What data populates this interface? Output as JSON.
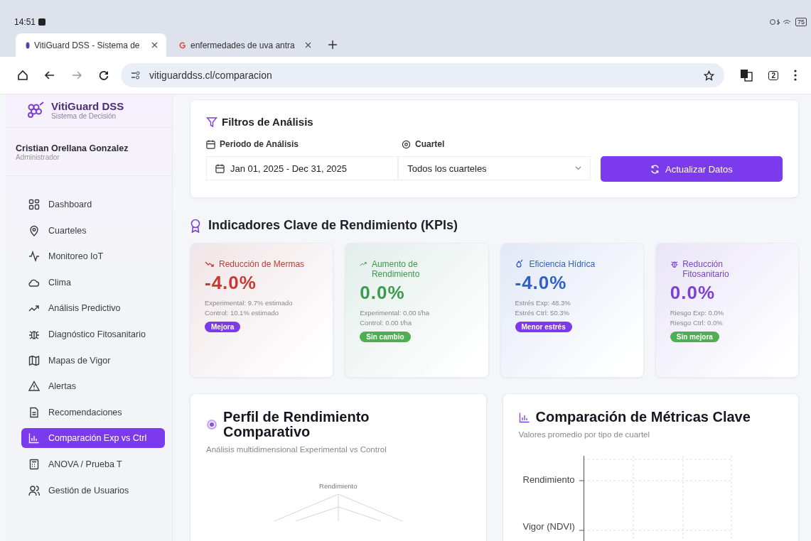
{
  "status_bar": {
    "time": "14:51",
    "battery": "75"
  },
  "browser_tabs": [
    {
      "title": "VitiGuard DSS - Sistema de",
      "selected": true
    },
    {
      "title": "enfermedades de uva antra",
      "selected": false
    }
  ],
  "address_bar": {
    "url": "vitiguarddss.cl/comparacion",
    "tab_count": "2"
  },
  "sidebar": {
    "brand": "VitiGuard DSS",
    "tagline": "Sistema de Decisión",
    "user": {
      "name": "Cristian Orellana Gonzalez",
      "role": "Administrador"
    },
    "items": [
      {
        "label": "Dashboard",
        "selected": false
      },
      {
        "label": "Cuarteles",
        "selected": false
      },
      {
        "label": "Monitoreo IoT",
        "selected": false
      },
      {
        "label": "Clima",
        "selected": false
      },
      {
        "label": "Análisis Predictivo",
        "selected": false
      },
      {
        "label": "Diagnóstico Fitosanitario",
        "selected": false
      },
      {
        "label": "Mapas de Vigor",
        "selected": false
      },
      {
        "label": "Alertas",
        "selected": false
      },
      {
        "label": "Recomendaciones",
        "selected": false
      },
      {
        "label": "Comparación Exp vs Ctrl",
        "selected": true
      },
      {
        "label": "ANOVA / Prueba T",
        "selected": false
      },
      {
        "label": "Gestión de Usuarios",
        "selected": false
      }
    ]
  },
  "filters": {
    "title": "Filtros de Análisis",
    "period": {
      "label": "Periodo de Análisis",
      "value": "Jan 01, 2025 - Dec 31, 2025"
    },
    "cuartel": {
      "label": "Cuartel",
      "value": "Todos los cuarteles"
    },
    "button": "Actualizar Datos"
  },
  "kpis": {
    "title": "Indicadores Clave de Rendimiento (KPIs)",
    "cards": [
      {
        "color": "#c63a32",
        "title": "Reducción de Mermas",
        "value": "-4.0%",
        "lines": [
          "Experimental: 9.7% estimado",
          "Control: 10.1% estimado"
        ],
        "badge": {
          "label": "Mejora",
          "color": "#7c3aed"
        }
      },
      {
        "color": "#3a9a4e",
        "title": "Aumento de Rendimiento",
        "value": "0.0%",
        "lines": [
          "Experimental: 0.00 t/ha",
          "Control: 0.00 t/ha"
        ],
        "badge": {
          "label": "Sin cambio",
          "color": "#4caf50"
        }
      },
      {
        "color": "#2f5fcf",
        "title": "Eficiencia Hídrica",
        "value": "-4.0%",
        "lines": [
          "Estrés Exp: 48.3%",
          "Estrés Ctrl: 50.3%"
        ],
        "badge": {
          "label": "Menor estrés",
          "color": "#7c3aed"
        }
      },
      {
        "color": "#7c3fd8",
        "title": "Reducción Fitosanitario",
        "value": "0.0%",
        "lines": [
          "Riesgo Exp: 0.0%",
          "Riesgo Ctrl: 0.0%"
        ],
        "badge": {
          "label": "Sin mejora",
          "color": "#4caf50"
        }
      }
    ]
  },
  "radar_panel": {
    "title": "Perfil de Rendimiento Comparativo",
    "subtitle": "Análisis multidimensional Experimental vs Control",
    "axis_labels": [
      "Rendimiento"
    ]
  },
  "bar_panel": {
    "title": "Comparación de Métricas Clave",
    "subtitle": "Valores promedio por tipo de cuartel",
    "category_labels": [
      "Rendimiento",
      "Vigor (NDVI)"
    ]
  }
}
